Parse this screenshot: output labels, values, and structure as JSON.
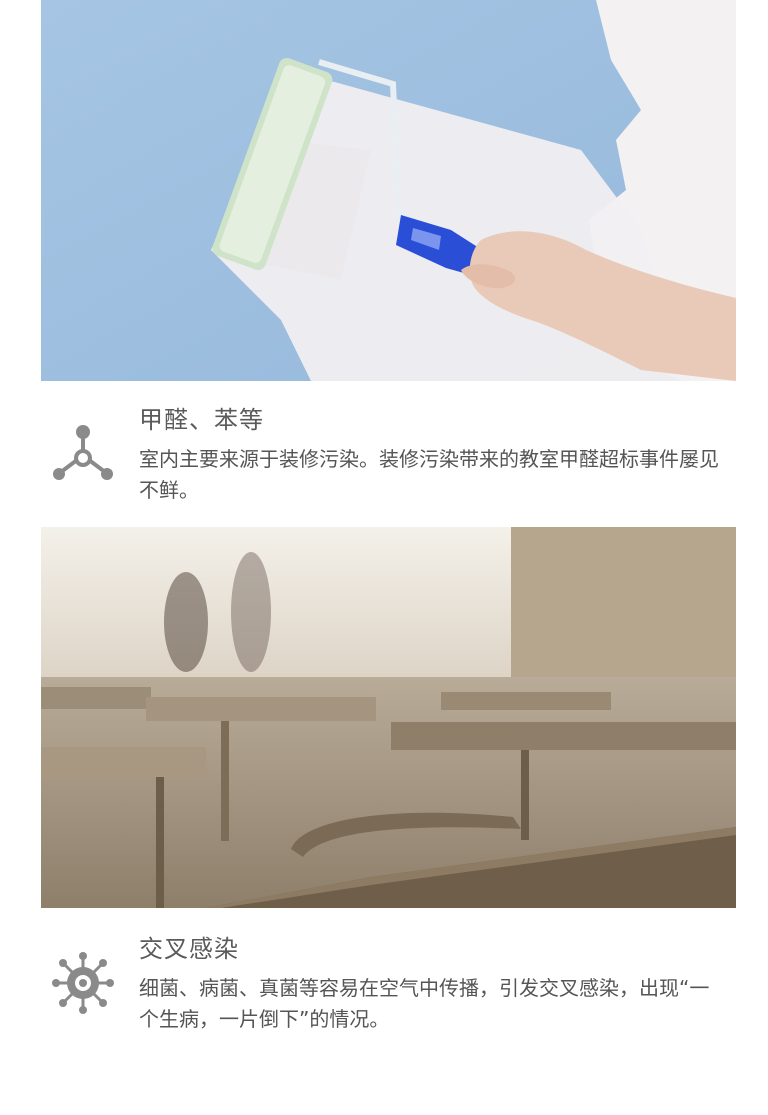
{
  "sections": [
    {
      "image": "wall-painting-roller-photo",
      "icon": "molecule-icon",
      "title": "甲醛、苯等",
      "description": "室内主要来源于装修污染。装修污染带来的教室甲醛超标事件屡见不鲜。"
    },
    {
      "image": "empty-classroom-photo",
      "icon": "bacteria-icon",
      "title": "交叉感染",
      "description": "细菌、病菌、真菌等容易在空气中传播，引发交叉感染，出现“一个生病，一片倒下”的情况。"
    }
  ],
  "colors": {
    "text": "#555555",
    "icon": "#8a8a8a",
    "wall_blue": "#a9c8e6",
    "roller_blue": "#2a4fd6"
  }
}
